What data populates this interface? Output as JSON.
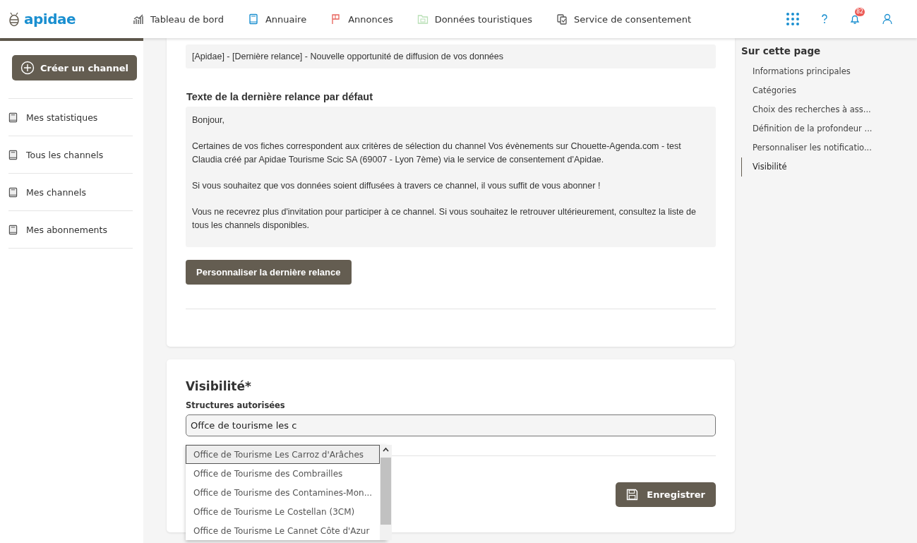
{
  "header": {
    "logo": "apidae",
    "nav": [
      {
        "label": "Tableau de bord",
        "kind": "chart"
      },
      {
        "label": "Annuaire",
        "kind": "book"
      },
      {
        "label": "Annonces",
        "kind": "flag"
      },
      {
        "label": "Données touristiques",
        "kind": "folder"
      },
      {
        "label": "Service de consentement",
        "kind": "consent"
      }
    ],
    "notification_count": "82"
  },
  "sidebar": {
    "create_button": "Créer un channel",
    "items": [
      {
        "label": "Mes statistiques"
      },
      {
        "label": "Tous les channels"
      },
      {
        "label": "Mes channels"
      },
      {
        "label": "Mes abonnements"
      }
    ]
  },
  "relance_card": {
    "subject": "[Apidae] - [Dernière relance] - Nouvelle opportunité de diffusion de vos données",
    "text_label": "Texte de la dernière relance par défaut",
    "paragraphs": [
      "Bonjour,",
      "Certaines de vos fiches correspondent aux critères de sélection du channel Vos évènements sur Chouette-Agenda.com - test Claudia créé par Apidae Tourisme Scic SA (69007 - Lyon 7ème) via le service de consentement d'Apidae.",
      "Si vous souhaitez que vos données soient diffusées à travers ce channel, il vous suffit de vous abonner !",
      "Vous ne recevrez plus d'invitation pour participer à ce channel. Si vous souhaitez le retrouver ultérieurement, consultez la liste de tous les channels disponibles."
    ],
    "button": "Personnaliser la dernière relance"
  },
  "visibility_card": {
    "title": "Visibilité*",
    "field_label": "Structures autorisées",
    "field_value": "Offce de tourisme les c",
    "suggestions": [
      {
        "label": "Office de Tourisme Les Carroz d'Arâches",
        "selected": true
      },
      {
        "label": "Office de Tourisme des Combrailles",
        "selected": false
      },
      {
        "label": "Office de Tourisme des Contamines-Mon...",
        "selected": false
      },
      {
        "label": "Office de Tourisme Le Costellan (3CM)",
        "selected": false
      },
      {
        "label": "Office de Tourisme Le Cannet Côte d'Azur",
        "selected": false
      }
    ],
    "save_button": "Enregistrer"
  },
  "toc": {
    "title": "Sur cette page",
    "items": [
      {
        "label": "Informations principales",
        "selected": false
      },
      {
        "label": "Catégories",
        "selected": false
      },
      {
        "label": "Choix des recherches à ass...",
        "selected": false
      },
      {
        "label": "Définition de la profondeur ...",
        "selected": false
      },
      {
        "label": "Personnaliser les notificatio...",
        "selected": false
      },
      {
        "label": "Visibilité",
        "selected": true
      }
    ]
  }
}
